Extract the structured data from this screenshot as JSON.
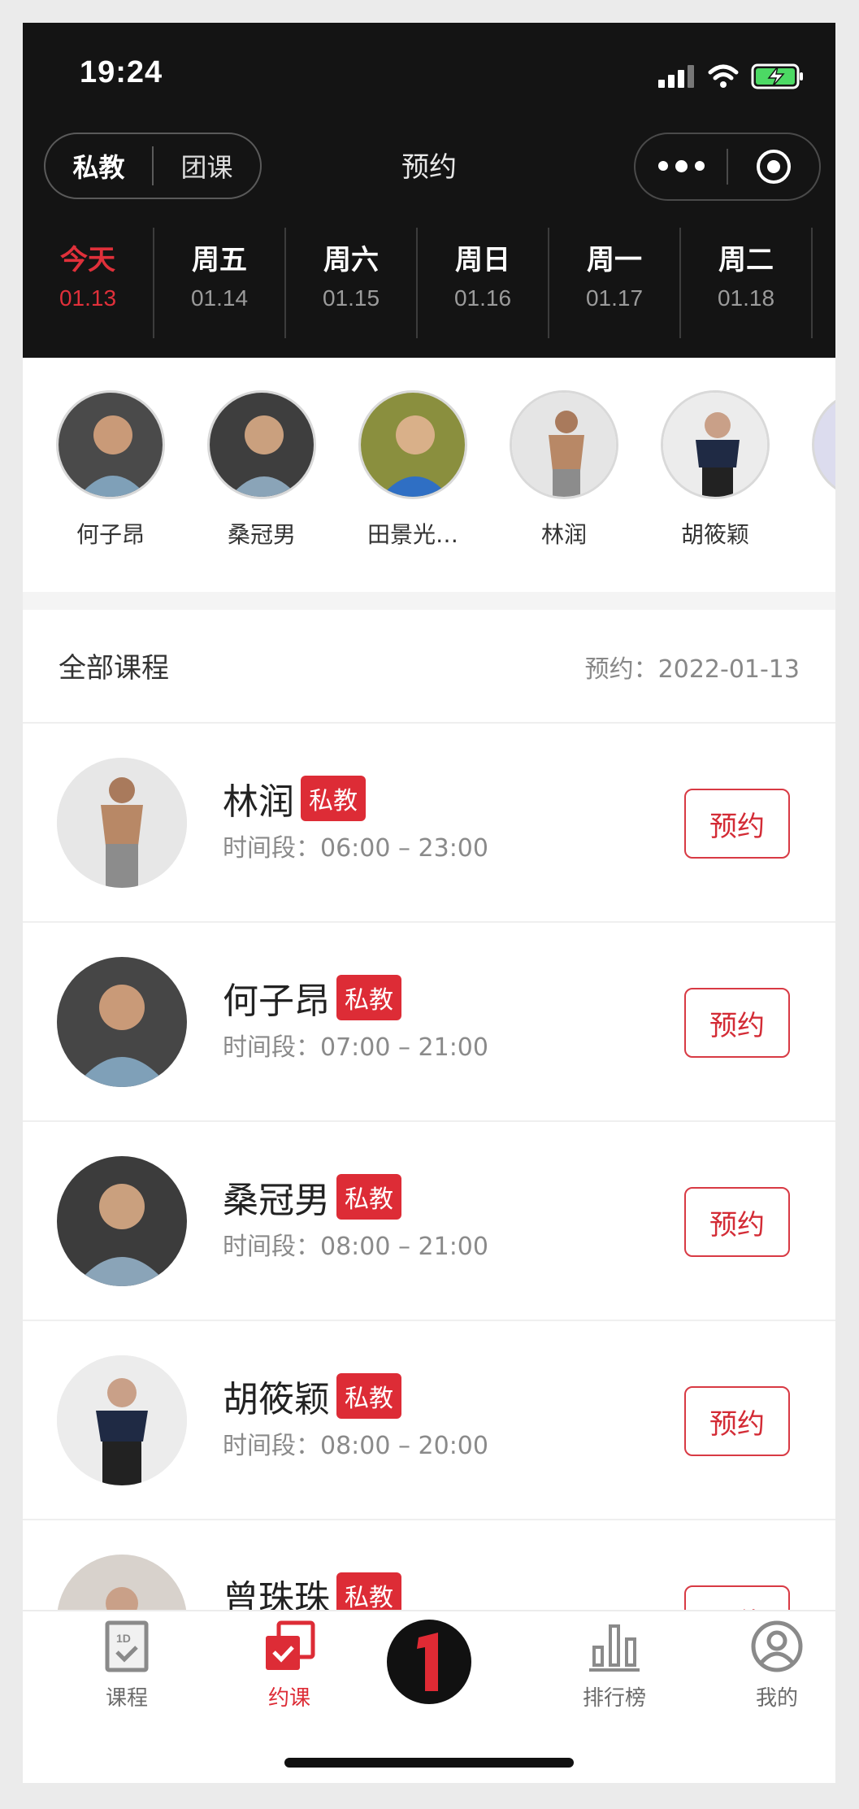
{
  "status_bar": {
    "time": "19:24"
  },
  "header": {
    "segment": {
      "active": "私教",
      "inactive": "团课"
    },
    "title": "预约"
  },
  "days": [
    {
      "name": "今天",
      "date": "01.13",
      "selected": true
    },
    {
      "name": "周五",
      "date": "01.14"
    },
    {
      "name": "周六",
      "date": "01.15"
    },
    {
      "name": "周日",
      "date": "01.16"
    },
    {
      "name": "周一",
      "date": "01.17"
    },
    {
      "name": "周二",
      "date": "01.18"
    }
  ],
  "coach_strip": [
    "何子昂",
    "桑冠男",
    "田景光…",
    "林润",
    "胡筱颖"
  ],
  "list_header": {
    "title": "全部课程",
    "booking_label": "预约：2022-01-13"
  },
  "courses": [
    {
      "name": "林润",
      "badge": "私教",
      "time": "时间段：06:00 – 23:00",
      "button": "预约"
    },
    {
      "name": "何子昂",
      "badge": "私教",
      "time": "时间段：07:00 – 21:00",
      "button": "预约"
    },
    {
      "name": "桑冠男",
      "badge": "私教",
      "time": "时间段：08:00 – 21:00",
      "button": "预约"
    },
    {
      "name": "胡筱颖",
      "badge": "私教",
      "time": "时间段：08:00 – 20:00",
      "button": "预约"
    },
    {
      "name": "曾珠珠",
      "badge": "私教",
      "time": "",
      "button": "预约"
    }
  ],
  "tabbar": {
    "items": [
      {
        "label": "课程",
        "icon": "course-clipboard-icon"
      },
      {
        "label": "约课",
        "icon": "book-class-icon",
        "active": true
      },
      {
        "label": "",
        "icon": "brand-logo-icon"
      },
      {
        "label": "排行榜",
        "icon": "ranking-bars-icon"
      },
      {
        "label": "我的",
        "icon": "profile-icon"
      }
    ]
  },
  "colors": {
    "accent": "#dd2c36",
    "header_bg": "#141414"
  }
}
